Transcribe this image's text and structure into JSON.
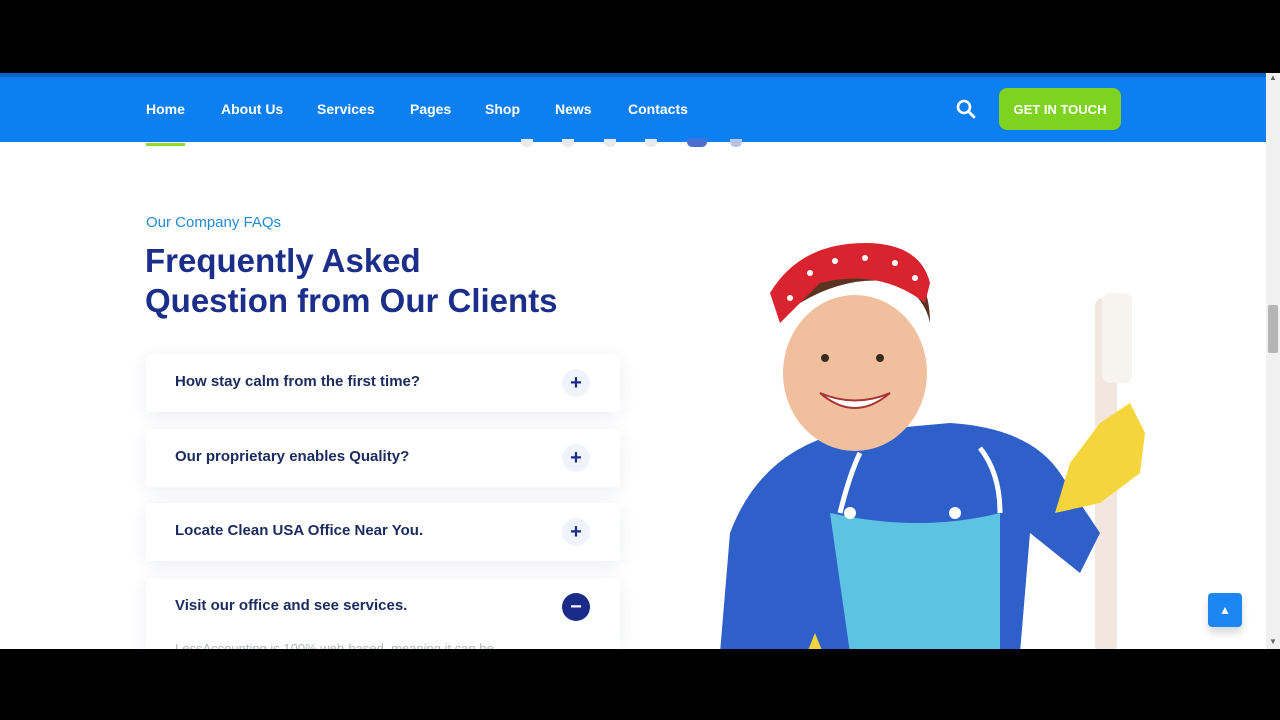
{
  "nav": {
    "items": [
      {
        "label": "Home",
        "active": true
      },
      {
        "label": "About Us"
      },
      {
        "label": "Services"
      },
      {
        "label": "Pages"
      },
      {
        "label": "Shop"
      },
      {
        "label": "News"
      },
      {
        "label": "Contacts"
      }
    ],
    "search_icon": "search-icon",
    "cta_label": "GET IN TOUCH"
  },
  "faq": {
    "eyebrow": "Our Company FAQs",
    "title_line1": "Frequently Asked",
    "title_line2": "Question from Our Clients",
    "items": [
      {
        "question": "How stay calm from the first time?",
        "toggle": "+"
      },
      {
        "question": "Our proprietary enables Quality?",
        "toggle": "+"
      },
      {
        "question": "Locate Clean USA Office Near You.",
        "toggle": "+"
      },
      {
        "question": "Visit our office and see services.",
        "toggle": "−",
        "open": true
      }
    ],
    "answer_preview": "LessAccounting is 100% web-based, meaning it can be"
  },
  "colors": {
    "nav_bg": "#0d7ff0",
    "cta_bg": "#7ed321",
    "title": "#1b2f8a",
    "eyebrow": "#1f8bd6"
  },
  "back_to_top_icon": "chevron-up-icon"
}
